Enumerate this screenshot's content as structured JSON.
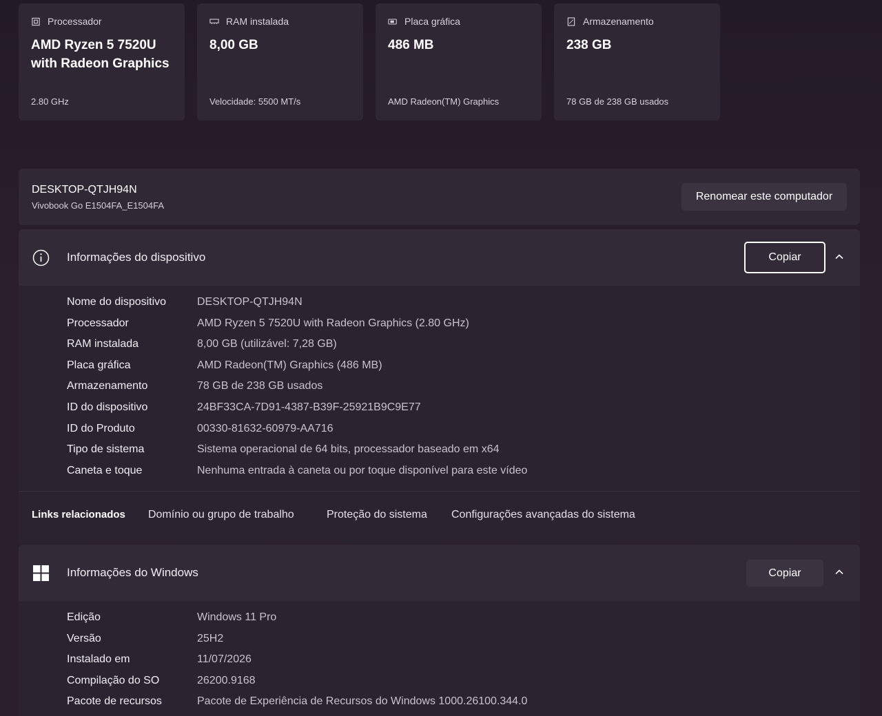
{
  "cards": [
    {
      "icon": "cpu-icon",
      "label": "Processador",
      "value": "AMD Ryzen 5 7520U with Radeon Graphics",
      "sub": "2.80 GHz"
    },
    {
      "icon": "ram-icon",
      "label": "RAM instalada",
      "value": "8,00 GB",
      "sub": "Velocidade: 5500 MT/s"
    },
    {
      "icon": "gpu-icon",
      "label": "Placa gráfica",
      "value": "486 MB",
      "sub": "AMD Radeon(TM) Graphics"
    },
    {
      "icon": "storage-icon",
      "label": "Armazenamento",
      "value": "238 GB",
      "sub": "78 GB de 238 GB usados"
    }
  ],
  "computer": {
    "name": "DESKTOP-QTJH94N",
    "model": "Vivobook Go E1504FA_E1504FA",
    "rename_label": "Renomear este computador"
  },
  "device_info": {
    "title": "Informações do dispositivo",
    "copy_label": "Copiar",
    "rows": [
      {
        "label": "Nome do dispositivo",
        "value": "DESKTOP-QTJH94N"
      },
      {
        "label": "Processador",
        "value": "AMD Ryzen 5 7520U with Radeon Graphics (2.80 GHz)"
      },
      {
        "label": "RAM instalada",
        "value": "8,00 GB (utilizável: 7,28 GB)"
      },
      {
        "label": "Placa gráfica",
        "value": "AMD Radeon(TM) Graphics (486 MB)"
      },
      {
        "label": "Armazenamento",
        "value": "78 GB de 238 GB usados"
      },
      {
        "label": "ID do dispositivo",
        "value": "24BF33CA-7D91-4387-B39F-25921B9C9E77"
      },
      {
        "label": "ID do Produto",
        "value": "00330-81632-60979-AA716"
      },
      {
        "label": "Tipo de sistema",
        "value": "Sistema operacional de 64 bits, processador baseado em x64"
      },
      {
        "label": "Caneta e toque",
        "value": "Nenhuma entrada à caneta ou por toque disponível para este vídeo"
      }
    ]
  },
  "related_links": {
    "label": "Links relacionados",
    "items": [
      "Domínio ou grupo de trabalho",
      "Proteção do sistema",
      "Configurações avançadas do sistema"
    ]
  },
  "windows_info": {
    "title": "Informações do Windows",
    "copy_label": "Copiar",
    "rows": [
      {
        "label": "Edição",
        "value": "Windows 11 Pro"
      },
      {
        "label": "Versão",
        "value": "25H2"
      },
      {
        "label": "Instalado em",
        "value": "11/07/2026"
      },
      {
        "label": "Compilação do SO",
        "value": "26200.9168"
      },
      {
        "label": "Pacote de recursos",
        "value": "Pacote de Experiência de Recursos do Windows 1000.26100.344.0"
      }
    ]
  }
}
